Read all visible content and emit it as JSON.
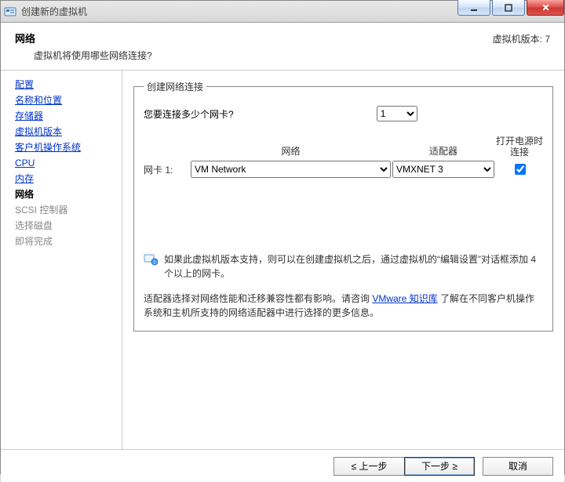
{
  "window": {
    "title": "创建新的虚拟机"
  },
  "header": {
    "heading": "网络",
    "subheading": "虚拟机将使用哪些网络连接?",
    "version_label": "虚拟机版本: 7"
  },
  "sidebar": {
    "steps": [
      {
        "label": "配置",
        "state": "done"
      },
      {
        "label": "名称和位置",
        "state": "done"
      },
      {
        "label": "存储器",
        "state": "done"
      },
      {
        "label": "虚拟机版本",
        "state": "done"
      },
      {
        "label": "客户机操作系统",
        "state": "done"
      },
      {
        "label": "CPU",
        "state": "done"
      },
      {
        "label": "内存",
        "state": "done"
      },
      {
        "label": "网络",
        "state": "current"
      },
      {
        "label": "SCSI 控制器",
        "state": "future"
      },
      {
        "label": "选择磁盘",
        "state": "future"
      },
      {
        "label": "即将完成",
        "state": "future"
      }
    ]
  },
  "group": {
    "legend": "创建网络连接",
    "nic_count_label": "您要连接多少个网卡?",
    "nic_count_value": "1",
    "headers": {
      "network": "网络",
      "adapter": "适配器",
      "connect": "打开电源时连接"
    },
    "nic": {
      "label": "网卡 1:",
      "network_value": "VM Network",
      "adapter_value": "VMXNET 3",
      "connect_checked": true
    },
    "info_text": "如果此虚拟机版本支持，则可以在创建虚拟机之后，通过虚拟机的“编辑设置”对话框添加 4 个以上的网卡。",
    "note_pre": "适配器选择对网络性能和迁移兼容性都有影响。请咨询 ",
    "note_link": "VMware 知识库",
    "note_post": " 了解在不同客户机操作系统和主机所支持的网络适配器中进行选择的更多信息。"
  },
  "footer": {
    "back": "≤ 上一步",
    "next": "下一步 ≥",
    "cancel": "取消"
  }
}
